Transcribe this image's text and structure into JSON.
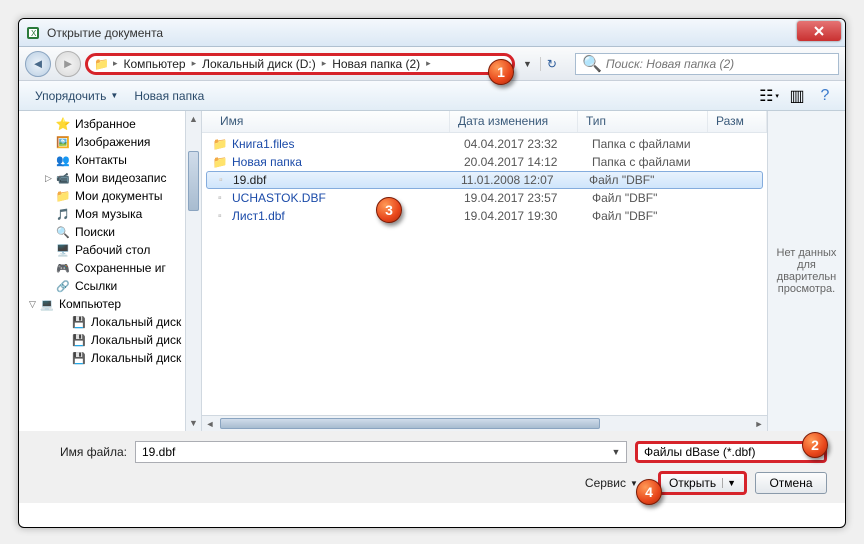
{
  "window": {
    "title": "Открытие документа"
  },
  "breadcrumb": {
    "root": "Компьютер",
    "drive": "Локальный диск (D:)",
    "folder": "Новая папка (2)"
  },
  "search": {
    "placeholder": "Поиск: Новая папка (2)"
  },
  "toolbar": {
    "organize": "Упорядочить",
    "new_folder": "Новая папка"
  },
  "sidebar": {
    "items": [
      {
        "label": "Избранное",
        "icon": "star-icon"
      },
      {
        "label": "Изображения",
        "icon": "pic-icon"
      },
      {
        "label": "Контакты",
        "icon": "contact-icon"
      },
      {
        "label": "Мои видеозапис",
        "icon": "video-icon"
      },
      {
        "label": "Мои документы",
        "icon": "folder-icon"
      },
      {
        "label": "Моя музыка",
        "icon": "music-icon"
      },
      {
        "label": "Поиски",
        "icon": "search-icon"
      },
      {
        "label": "Рабочий стол",
        "icon": "desktop-icon"
      },
      {
        "label": "Сохраненные иг",
        "icon": "game-icon"
      },
      {
        "label": "Ссылки",
        "icon": "link-icon"
      },
      {
        "label": "Компьютер",
        "icon": "computer-icon",
        "root": true
      },
      {
        "label": "Локальный диск",
        "icon": "disk-icon",
        "drive": true
      },
      {
        "label": "Локальный диск",
        "icon": "disk-icon",
        "drive": true
      },
      {
        "label": "Локальный диск",
        "icon": "disk-icon",
        "drive": true
      }
    ]
  },
  "columns": {
    "name": "Имя",
    "date": "Дата изменения",
    "type": "Тип",
    "size": "Разм"
  },
  "files": {
    "items": [
      {
        "name": "Книга1.files",
        "date": "04.04.2017 23:32",
        "type": "Папка с файлами",
        "folder": true
      },
      {
        "name": "Новая папка",
        "date": "20.04.2017 14:12",
        "type": "Папка с файлами",
        "folder": true
      },
      {
        "name": "19.dbf",
        "date": "11.01.2008 12:07",
        "type": "Файл \"DBF\"",
        "selected": true
      },
      {
        "name": "UCHASTOK.DBF",
        "date": "19.04.2017 23:57",
        "type": "Файл \"DBF\""
      },
      {
        "name": "Лист1.dbf",
        "date": "19.04.2017 19:30",
        "type": "Файл \"DBF\""
      }
    ]
  },
  "preview": {
    "text": "Нет данных для дварительн просмотра."
  },
  "bottom": {
    "filename_label": "Имя файла:",
    "filename_value": "19.dbf",
    "filetype_value": "Файлы dBase (*.dbf)",
    "tools_label": "Сервис",
    "open_label": "Открыть",
    "cancel_label": "Отмена"
  },
  "badges": {
    "b1": "1",
    "b2": "2",
    "b3": "3",
    "b4": "4"
  }
}
